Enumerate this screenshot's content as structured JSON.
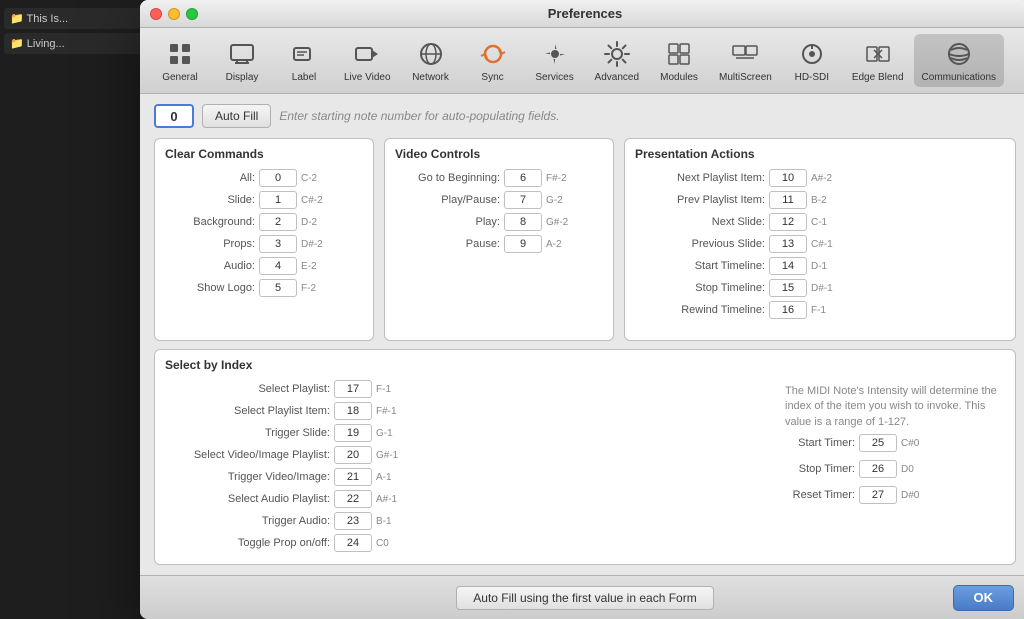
{
  "window": {
    "title": "Preferences",
    "controls": {
      "close": "close",
      "minimize": "minimize",
      "maximize": "maximize"
    }
  },
  "toolbar": {
    "items": [
      {
        "id": "general",
        "label": "General",
        "icon": "⚙️"
      },
      {
        "id": "display",
        "label": "Display",
        "icon": "🖥"
      },
      {
        "id": "label",
        "label": "Label",
        "icon": "🏷"
      },
      {
        "id": "live_video",
        "label": "Live Video",
        "icon": "📹"
      },
      {
        "id": "network",
        "label": "Network",
        "icon": "🌐"
      },
      {
        "id": "sync",
        "label": "Sync",
        "icon": "🔄"
      },
      {
        "id": "services",
        "label": "Services",
        "icon": "🔧"
      },
      {
        "id": "advanced",
        "label": "Advanced",
        "icon": "🎛"
      },
      {
        "id": "modules",
        "label": "Modules",
        "icon": "📦"
      },
      {
        "id": "multiscreen",
        "label": "MultiScreen",
        "icon": "🖥"
      },
      {
        "id": "hd_sdi",
        "label": "HD-SDI",
        "icon": "📡"
      },
      {
        "id": "edge_blend",
        "label": "Edge Blend",
        "icon": "🔀"
      },
      {
        "id": "communications",
        "label": "Communications",
        "icon": "📶",
        "active": true
      }
    ]
  },
  "autofill": {
    "value": "0",
    "button_label": "Auto Fill",
    "hint": "Enter starting note number for auto-populating fields."
  },
  "clear_commands": {
    "title": "Clear Commands",
    "rows": [
      {
        "label": "All:",
        "value": "0",
        "note": "C-2"
      },
      {
        "label": "Slide:",
        "value": "1",
        "note": "C#-2"
      },
      {
        "label": "Background:",
        "value": "2",
        "note": "D-2"
      },
      {
        "label": "Props:",
        "value": "3",
        "note": "D#-2"
      },
      {
        "label": "Audio:",
        "value": "4",
        "note": "E-2"
      },
      {
        "label": "Show Logo:",
        "value": "5",
        "note": "F-2"
      }
    ]
  },
  "video_controls": {
    "title": "Video Controls",
    "rows": [
      {
        "label": "Go to Beginning:",
        "value": "6",
        "note": "F#-2"
      },
      {
        "label": "Play/Pause:",
        "value": "7",
        "note": "G-2"
      },
      {
        "label": "Play:",
        "value": "8",
        "note": "G#-2"
      },
      {
        "label": "Pause:",
        "value": "9",
        "note": "A-2"
      }
    ]
  },
  "presentation_actions": {
    "title": "Presentation Actions",
    "rows": [
      {
        "label": "Next Playlist Item:",
        "value": "10",
        "note": "A#-2"
      },
      {
        "label": "Prev Playlist Item:",
        "value": "11",
        "note": "B-2"
      },
      {
        "label": "Next Slide:",
        "value": "12",
        "note": "C-1"
      },
      {
        "label": "Previous Slide:",
        "value": "13",
        "note": "C#-1"
      },
      {
        "label": "Start Timeline:",
        "value": "14",
        "note": "D-1"
      },
      {
        "label": "Stop Timeline:",
        "value": "15",
        "note": "D#-1"
      },
      {
        "label": "Rewind Timeline:",
        "value": "16",
        "note": "F-1"
      }
    ]
  },
  "select_by_index": {
    "title": "Select by Index",
    "rows": [
      {
        "label": "Select Playlist:",
        "value": "17",
        "note": "F-1"
      },
      {
        "label": "Select Playlist Item:",
        "value": "18",
        "note": "F#-1"
      },
      {
        "label": "Trigger Slide:",
        "value": "19",
        "note": "G-1"
      },
      {
        "label": "Select Video/Image Playlist:",
        "value": "20",
        "note": "G#-1"
      },
      {
        "label": "Trigger Video/Image:",
        "value": "21",
        "note": "A-1"
      },
      {
        "label": "Select Audio Playlist:",
        "value": "22",
        "note": "A#-1"
      },
      {
        "label": "Trigger Audio:",
        "value": "23",
        "note": "B-1"
      },
      {
        "label": "Toggle Prop on/off:",
        "value": "24",
        "note": "C0"
      }
    ],
    "timers": [
      {
        "label": "Start Timer:",
        "value": "25",
        "note": "C#0"
      },
      {
        "label": "Stop Timer:",
        "value": "26",
        "note": "D0"
      },
      {
        "label": "Reset Timer:",
        "value": "27",
        "note": "D#0"
      }
    ],
    "note": "The MIDI Note's Intensity will determine the index of the item you wish to invoke. This value is a range of 1-127."
  },
  "bottom": {
    "fill_button_label": "Auto Fill using the first value in each Form",
    "ok_label": "OK"
  }
}
